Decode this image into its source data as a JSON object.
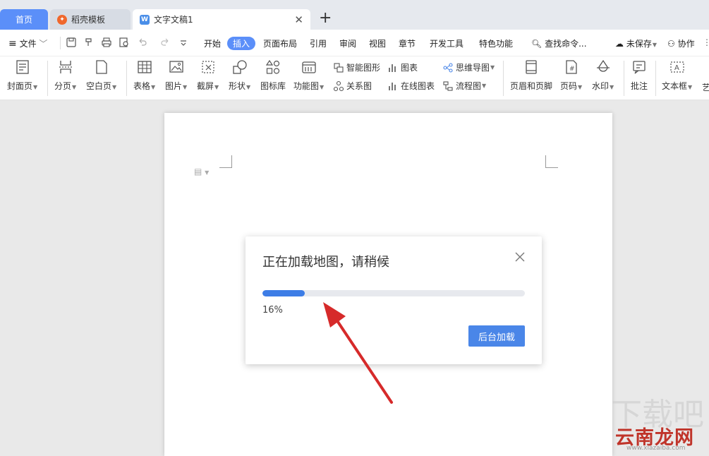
{
  "tabs": {
    "home": "首页",
    "templates": "稻壳模板",
    "document": "文字文稿1",
    "new_tab": "+"
  },
  "menubar": {
    "file": "文件",
    "items": [
      "开始",
      "插入",
      "页面布局",
      "引用",
      "审阅",
      "视图",
      "章节",
      "开发工具",
      "特色功能"
    ],
    "active_item": "插入",
    "search": "查找命令...",
    "unsaved": "未保存",
    "collab": "协作"
  },
  "ribbon": {
    "cover": "封面页",
    "page_break": "分页",
    "blank_page": "空白页",
    "table": "表格",
    "image": "图片",
    "screenshot": "截屏",
    "shape": "形状",
    "icon_lib": "图标库",
    "func_chart": "功能图",
    "smart_shape": "智能图形",
    "relation": "关系图",
    "chart": "图表",
    "online_chart": "在线图表",
    "mindmap": "思维导图",
    "flowchart": "流程图",
    "header_footer": "页眉和页脚",
    "page_num": "页码",
    "watermark": "水印",
    "comment": "批注",
    "textbox": "文本框",
    "art": "艺"
  },
  "dialog": {
    "title": "正在加载地图，请稍候",
    "progress_percent": 16,
    "progress_label": "16%",
    "background_button": "后台加载"
  },
  "watermark": {
    "text": "云南龙网",
    "url": "www.xiazaiba.com"
  },
  "colors": {
    "accent": "#5b8ff9",
    "button": "#4a86e8",
    "progress": "#3d7de6",
    "arrow": "#d62a2a"
  }
}
